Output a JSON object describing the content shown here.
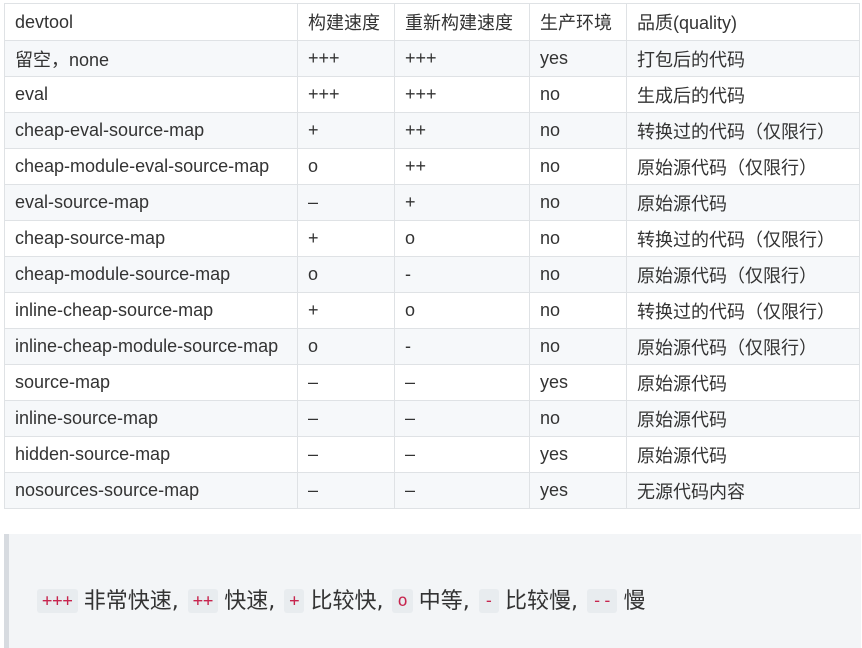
{
  "table": {
    "headers": [
      "devtool",
      "构建速度",
      "重新构建速度",
      "生产环境",
      "品质(quality)"
    ],
    "rows": [
      [
        "留空，none",
        "+++",
        "+++",
        "yes",
        "打包后的代码"
      ],
      [
        "eval",
        "+++",
        "+++",
        "no",
        "生成后的代码"
      ],
      [
        "cheap-eval-source-map",
        "+",
        "++",
        "no",
        "转换过的代码（仅限行）"
      ],
      [
        "cheap-module-eval-source-map",
        "o",
        "++",
        "no",
        "原始源代码（仅限行）"
      ],
      [
        "eval-source-map",
        "–",
        "+",
        "no",
        "原始源代码"
      ],
      [
        "cheap-source-map",
        "+",
        "o",
        "no",
        "转换过的代码（仅限行）"
      ],
      [
        "cheap-module-source-map",
        "o",
        "-",
        "no",
        "原始源代码（仅限行）"
      ],
      [
        "inline-cheap-source-map",
        "+",
        "o",
        "no",
        "转换过的代码（仅限行）"
      ],
      [
        "inline-cheap-module-source-map",
        "o",
        "-",
        "no",
        "原始源代码（仅限行）"
      ],
      [
        "source-map",
        "–",
        "–",
        "yes",
        "原始源代码"
      ],
      [
        "inline-source-map",
        "–",
        "–",
        "no",
        "原始源代码"
      ],
      [
        "hidden-source-map",
        "–",
        "–",
        "yes",
        "原始源代码"
      ],
      [
        "nosources-source-map",
        "–",
        "–",
        "yes",
        "无源代码内容"
      ]
    ]
  },
  "legend": {
    "items": [
      {
        "code": "+++",
        "label": "非常快速,"
      },
      {
        "code": "++",
        "label": "快速,"
      },
      {
        "code": "+",
        "label": "比较快,"
      },
      {
        "code": "o",
        "label": "中等,"
      },
      {
        "code": "-",
        "label": "比较慢,"
      },
      {
        "code": "--",
        "label": "慢"
      }
    ]
  }
}
